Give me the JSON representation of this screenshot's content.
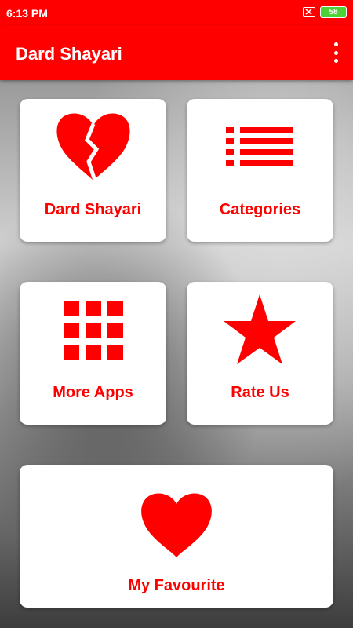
{
  "status": {
    "time": "6:13 PM",
    "battery": "58"
  },
  "appbar": {
    "title": "Dard Shayari"
  },
  "tiles": {
    "dard_shayari": "Dard Shayari",
    "categories": "Categories",
    "more_apps": "More Apps",
    "rate_us": "Rate Us",
    "my_favourite": "My Favourite"
  },
  "colors": {
    "primary": "#ff0000",
    "battery": "#4cd137",
    "card": "#ffffff"
  },
  "icons": [
    "broken-heart-icon",
    "list-icon",
    "grid-icon",
    "star-icon",
    "heart-icon",
    "overflow-menu-icon",
    "close-icon"
  ]
}
